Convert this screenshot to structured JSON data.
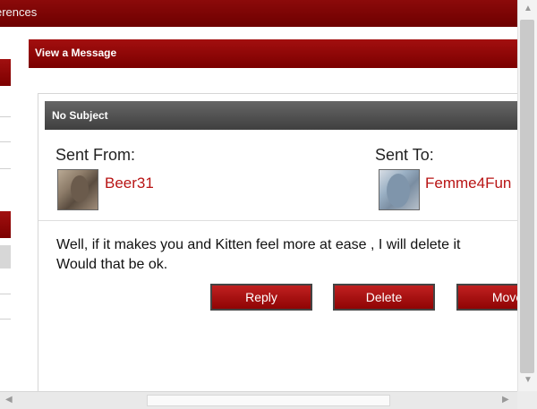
{
  "nav": {
    "partial_label": "erences"
  },
  "main": {
    "header": "View a Message",
    "message": {
      "subject": "No Subject",
      "from_label": "Sent From:",
      "from_user": "Beer31",
      "to_label": "Sent To:",
      "to_user": "Femme4Fun",
      "body_line1": "Well, if it makes you and Kitten feel more at ease , I will delete it",
      "body_line2": "Would that be ok."
    },
    "buttons": {
      "reply": "Reply",
      "delete": "Delete",
      "move": "Move"
    }
  },
  "colors": {
    "brand_red": "#8c0a0a",
    "subject_gray": "#4a4a4a",
    "link_red": "#b81414"
  }
}
